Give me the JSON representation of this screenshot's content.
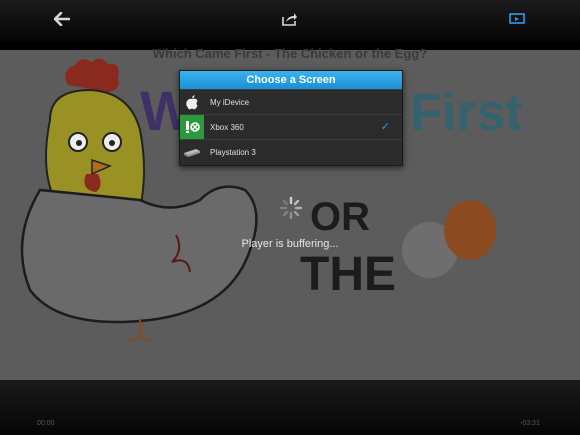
{
  "toolbar": {
    "back_icon": "back-arrow-icon",
    "share_icon": "share-icon",
    "screen_icon": "airplay-screen-icon"
  },
  "video": {
    "title": "Which Came First - The Chicken or the Egg?",
    "status": "Player is buffering...",
    "time_elapsed": "00:00",
    "time_remaining": "-03:31"
  },
  "dialog": {
    "header": "Choose a Screen",
    "options": [
      {
        "label": "My iDevice",
        "icon": "apple-icon",
        "selected": false
      },
      {
        "label": "Xbox 360",
        "icon": "xbox-icon",
        "selected": true
      },
      {
        "label": "Playstation 3",
        "icon": "ps3-console-icon",
        "selected": false
      }
    ],
    "check_mark": "✓"
  },
  "colors": {
    "accent": "#1a8fd6",
    "xbox_green": "#2a9b3a"
  }
}
